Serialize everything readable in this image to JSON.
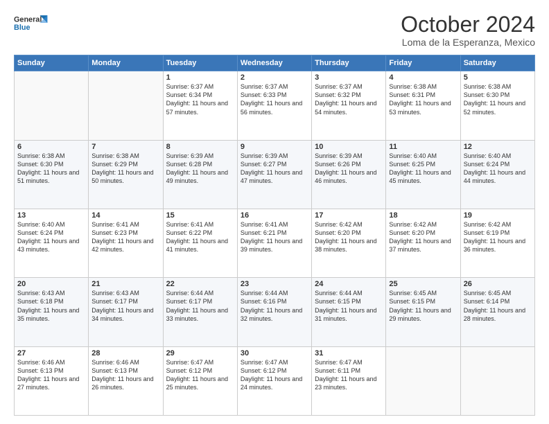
{
  "header": {
    "logo_text_general": "General",
    "logo_text_blue": "Blue",
    "month_title": "October 2024",
    "location": "Loma de la Esperanza, Mexico"
  },
  "weekdays": [
    "Sunday",
    "Monday",
    "Tuesday",
    "Wednesday",
    "Thursday",
    "Friday",
    "Saturday"
  ],
  "weeks": [
    [
      {
        "day": "",
        "content": ""
      },
      {
        "day": "",
        "content": ""
      },
      {
        "day": "1",
        "content": "Sunrise: 6:37 AM\nSunset: 6:34 PM\nDaylight: 11 hours and 57 minutes."
      },
      {
        "day": "2",
        "content": "Sunrise: 6:37 AM\nSunset: 6:33 PM\nDaylight: 11 hours and 56 minutes."
      },
      {
        "day": "3",
        "content": "Sunrise: 6:37 AM\nSunset: 6:32 PM\nDaylight: 11 hours and 54 minutes."
      },
      {
        "day": "4",
        "content": "Sunrise: 6:38 AM\nSunset: 6:31 PM\nDaylight: 11 hours and 53 minutes."
      },
      {
        "day": "5",
        "content": "Sunrise: 6:38 AM\nSunset: 6:30 PM\nDaylight: 11 hours and 52 minutes."
      }
    ],
    [
      {
        "day": "6",
        "content": "Sunrise: 6:38 AM\nSunset: 6:30 PM\nDaylight: 11 hours and 51 minutes."
      },
      {
        "day": "7",
        "content": "Sunrise: 6:38 AM\nSunset: 6:29 PM\nDaylight: 11 hours and 50 minutes."
      },
      {
        "day": "8",
        "content": "Sunrise: 6:39 AM\nSunset: 6:28 PM\nDaylight: 11 hours and 49 minutes."
      },
      {
        "day": "9",
        "content": "Sunrise: 6:39 AM\nSunset: 6:27 PM\nDaylight: 11 hours and 47 minutes."
      },
      {
        "day": "10",
        "content": "Sunrise: 6:39 AM\nSunset: 6:26 PM\nDaylight: 11 hours and 46 minutes."
      },
      {
        "day": "11",
        "content": "Sunrise: 6:40 AM\nSunset: 6:25 PM\nDaylight: 11 hours and 45 minutes."
      },
      {
        "day": "12",
        "content": "Sunrise: 6:40 AM\nSunset: 6:24 PM\nDaylight: 11 hours and 44 minutes."
      }
    ],
    [
      {
        "day": "13",
        "content": "Sunrise: 6:40 AM\nSunset: 6:24 PM\nDaylight: 11 hours and 43 minutes."
      },
      {
        "day": "14",
        "content": "Sunrise: 6:41 AM\nSunset: 6:23 PM\nDaylight: 11 hours and 42 minutes."
      },
      {
        "day": "15",
        "content": "Sunrise: 6:41 AM\nSunset: 6:22 PM\nDaylight: 11 hours and 41 minutes."
      },
      {
        "day": "16",
        "content": "Sunrise: 6:41 AM\nSunset: 6:21 PM\nDaylight: 11 hours and 39 minutes."
      },
      {
        "day": "17",
        "content": "Sunrise: 6:42 AM\nSunset: 6:20 PM\nDaylight: 11 hours and 38 minutes."
      },
      {
        "day": "18",
        "content": "Sunrise: 6:42 AM\nSunset: 6:20 PM\nDaylight: 11 hours and 37 minutes."
      },
      {
        "day": "19",
        "content": "Sunrise: 6:42 AM\nSunset: 6:19 PM\nDaylight: 11 hours and 36 minutes."
      }
    ],
    [
      {
        "day": "20",
        "content": "Sunrise: 6:43 AM\nSunset: 6:18 PM\nDaylight: 11 hours and 35 minutes."
      },
      {
        "day": "21",
        "content": "Sunrise: 6:43 AM\nSunset: 6:17 PM\nDaylight: 11 hours and 34 minutes."
      },
      {
        "day": "22",
        "content": "Sunrise: 6:44 AM\nSunset: 6:17 PM\nDaylight: 11 hours and 33 minutes."
      },
      {
        "day": "23",
        "content": "Sunrise: 6:44 AM\nSunset: 6:16 PM\nDaylight: 11 hours and 32 minutes."
      },
      {
        "day": "24",
        "content": "Sunrise: 6:44 AM\nSunset: 6:15 PM\nDaylight: 11 hours and 31 minutes."
      },
      {
        "day": "25",
        "content": "Sunrise: 6:45 AM\nSunset: 6:15 PM\nDaylight: 11 hours and 29 minutes."
      },
      {
        "day": "26",
        "content": "Sunrise: 6:45 AM\nSunset: 6:14 PM\nDaylight: 11 hours and 28 minutes."
      }
    ],
    [
      {
        "day": "27",
        "content": "Sunrise: 6:46 AM\nSunset: 6:13 PM\nDaylight: 11 hours and 27 minutes."
      },
      {
        "day": "28",
        "content": "Sunrise: 6:46 AM\nSunset: 6:13 PM\nDaylight: 11 hours and 26 minutes."
      },
      {
        "day": "29",
        "content": "Sunrise: 6:47 AM\nSunset: 6:12 PM\nDaylight: 11 hours and 25 minutes."
      },
      {
        "day": "30",
        "content": "Sunrise: 6:47 AM\nSunset: 6:12 PM\nDaylight: 11 hours and 24 minutes."
      },
      {
        "day": "31",
        "content": "Sunrise: 6:47 AM\nSunset: 6:11 PM\nDaylight: 11 hours and 23 minutes."
      },
      {
        "day": "",
        "content": ""
      },
      {
        "day": "",
        "content": ""
      }
    ]
  ]
}
